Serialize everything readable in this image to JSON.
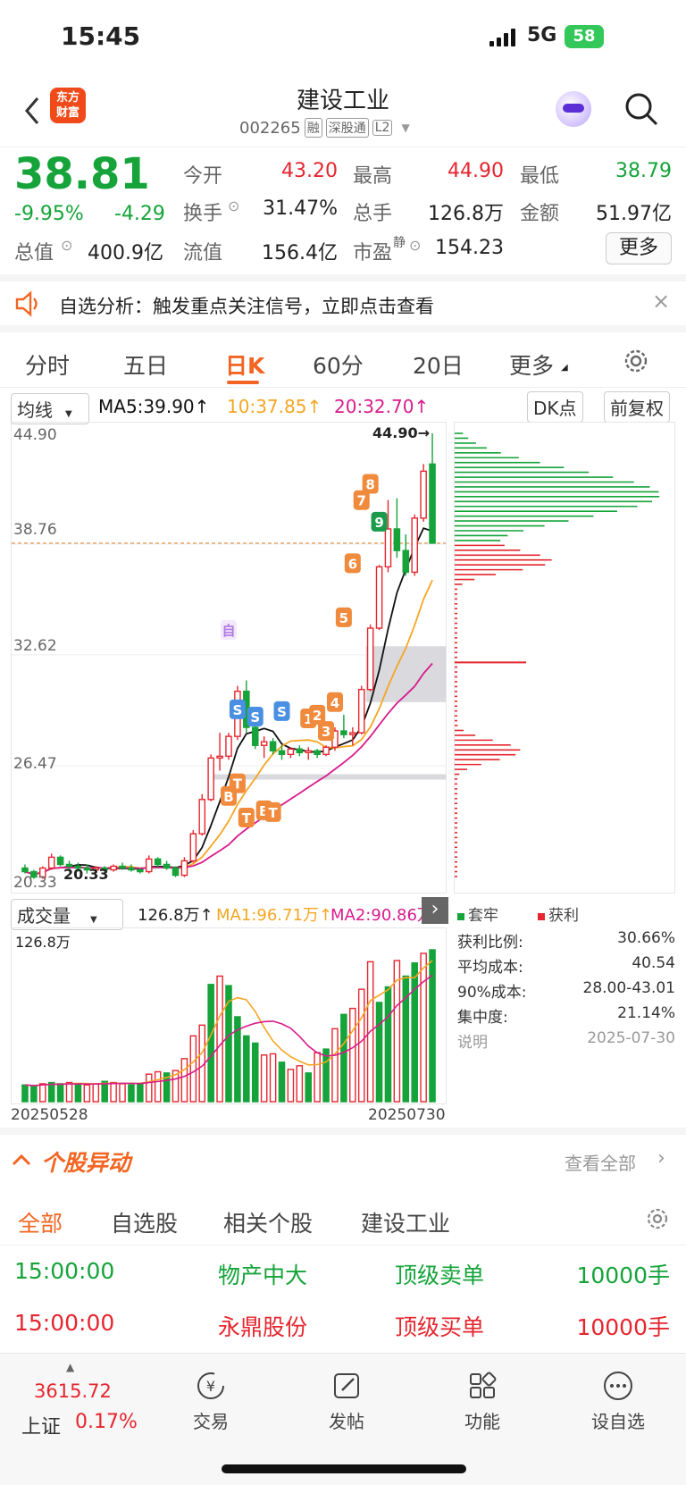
{
  "status_bar": {
    "time": "15:45",
    "network": "5G",
    "battery": "58"
  },
  "header": {
    "title": "建设工业",
    "code": "002265",
    "badges": [
      "融",
      "深股通",
      "L2"
    ],
    "brand": "东方\n财富"
  },
  "quote": {
    "price": "38.81",
    "change_pct": "-9.95%",
    "change": "-4.29",
    "fields": [
      {
        "label": "今开",
        "value": "43.20",
        "color": "red"
      },
      {
        "label": "最高",
        "value": "44.90",
        "color": "red"
      },
      {
        "label": "最低",
        "value": "38.79",
        "color": "green"
      },
      {
        "label": "换手",
        "value": "31.47%",
        "color": "black"
      },
      {
        "label": "总手",
        "value": "126.8万",
        "color": "black"
      },
      {
        "label": "金额",
        "value": "51.97亿",
        "color": "black"
      },
      {
        "label": "总值",
        "value": "400.9亿",
        "color": "black"
      },
      {
        "label": "流值",
        "value": "156.4亿",
        "color": "black"
      },
      {
        "label": "市盈",
        "value": "154.23",
        "color": "black",
        "sup": "静"
      }
    ],
    "more_label": "更多"
  },
  "banner": {
    "text": "自选分析：触发重点关注信号，立即点击查看"
  },
  "tabs": [
    "分时",
    "五日",
    "日K",
    "60分",
    "20日",
    "更多"
  ],
  "active_tab": "日K",
  "chart_bar": {
    "ma_select": "均线",
    "ma5": "MA5:39.90↑",
    "ma10": "10:37.85↑",
    "ma20": "20:32.70↑",
    "dk": "DK点",
    "adjust": "前复权"
  },
  "vol_bar": {
    "select": "成交量",
    "vol": "126.8万↑",
    "ma1": "MA1:96.71万↑",
    "ma2": "MA2:90.86万↑"
  },
  "colors": {
    "up": "#e5262f",
    "down": "#15a33a",
    "ma5": "#111111",
    "ma10": "#f5a623",
    "ma20": "#d81b8c"
  },
  "chart_data": {
    "type": "candlestick",
    "price_ticks": [
      "44.90",
      "38.76",
      "32.62",
      "26.47",
      "20.33"
    ],
    "high_marker": "44.90→",
    "low_marker": "20.33",
    "dates": [
      "20250528",
      "20250730"
    ],
    "vol_top_label": "126.8万",
    "markers": [
      "自",
      "S",
      "S",
      "S",
      "B",
      "T",
      "T",
      "B",
      "T",
      "1",
      "2",
      "3",
      "4",
      "5",
      "6",
      "7",
      "8",
      "9"
    ],
    "candles": [
      [
        20.8,
        21.0,
        20.5,
        20.6
      ],
      [
        20.6,
        20.7,
        20.2,
        20.3
      ],
      [
        20.3,
        20.9,
        20.2,
        20.8
      ],
      [
        20.8,
        21.6,
        20.7,
        21.4
      ],
      [
        21.4,
        21.5,
        20.9,
        21.0
      ],
      [
        21.0,
        21.2,
        20.7,
        20.9
      ],
      [
        20.9,
        21.1,
        20.6,
        20.8
      ],
      [
        20.8,
        21.0,
        20.5,
        20.7
      ],
      [
        20.7,
        20.9,
        20.5,
        20.8
      ],
      [
        20.8,
        20.9,
        20.6,
        20.7
      ],
      [
        20.7,
        21.0,
        20.6,
        20.9
      ],
      [
        20.9,
        21.1,
        20.7,
        20.8
      ],
      [
        20.8,
        21.0,
        20.6,
        20.7
      ],
      [
        20.7,
        20.8,
        20.5,
        20.6
      ],
      [
        20.6,
        21.5,
        20.5,
        21.3
      ],
      [
        21.3,
        21.4,
        20.8,
        21.0
      ],
      [
        21.0,
        21.2,
        20.7,
        20.8
      ],
      [
        20.8,
        20.9,
        20.3,
        20.4
      ],
      [
        20.4,
        21.4,
        20.3,
        21.2
      ],
      [
        21.2,
        22.9,
        21.1,
        22.7
      ],
      [
        22.7,
        24.9,
        22.6,
        24.6
      ],
      [
        24.6,
        27.1,
        24.5,
        26.9
      ],
      [
        26.9,
        28.3,
        26.2,
        27.0
      ],
      [
        27.0,
        28.3,
        26.8,
        28.1
      ],
      [
        28.1,
        30.9,
        27.9,
        30.6
      ],
      [
        30.6,
        31.2,
        28.3,
        28.6
      ],
      [
        28.6,
        28.9,
        27.4,
        27.6
      ],
      [
        27.6,
        28.1,
        26.9,
        27.8
      ],
      [
        27.8,
        28.0,
        27.1,
        27.3
      ],
      [
        27.3,
        27.6,
        26.8,
        27.1
      ],
      [
        27.1,
        27.5,
        26.9,
        27.4
      ],
      [
        27.4,
        27.6,
        27.0,
        27.2
      ],
      [
        27.2,
        27.5,
        26.8,
        27.3
      ],
      [
        27.3,
        27.4,
        26.9,
        27.1
      ],
      [
        27.1,
        27.6,
        27.0,
        27.5
      ],
      [
        27.5,
        28.6,
        27.3,
        28.4
      ],
      [
        28.4,
        29.3,
        28.0,
        28.2
      ],
      [
        28.2,
        28.6,
        27.6,
        28.3
      ],
      [
        28.3,
        30.9,
        28.2,
        30.7
      ],
      [
        30.7,
        34.3,
        30.6,
        34.1
      ],
      [
        34.1,
        37.6,
        34.0,
        37.5
      ],
      [
        37.5,
        41.2,
        37.2,
        39.6
      ],
      [
        39.6,
        41.3,
        38.0,
        38.4
      ],
      [
        38.4,
        39.3,
        37.0,
        37.2
      ],
      [
        37.2,
        40.4,
        37.0,
        40.2
      ],
      [
        40.2,
        43.2,
        40.0,
        42.8
      ],
      [
        43.2,
        44.9,
        38.79,
        38.81
      ]
    ],
    "volumes": [
      14,
      13,
      15,
      16,
      15,
      16,
      15,
      14,
      15,
      17,
      16,
      15,
      14,
      15,
      23,
      25,
      24,
      26,
      36,
      55,
      64,
      98,
      105,
      97,
      71,
      55,
      49,
      39,
      40,
      33,
      27,
      30,
      24,
      41,
      44,
      61,
      73,
      78,
      94,
      117,
      83,
      96,
      118,
      105,
      116,
      124,
      127
    ],
    "vol_up": [
      false,
      false,
      true,
      false,
      false,
      true,
      false,
      true,
      true,
      false,
      true,
      true,
      false,
      false,
      true,
      true,
      false,
      true,
      true,
      true,
      true,
      false,
      true,
      false,
      false,
      false,
      false,
      true,
      true,
      false,
      true,
      true,
      false,
      true,
      false,
      true,
      false,
      true,
      true,
      true,
      false,
      false,
      true,
      false,
      false,
      true,
      false
    ],
    "profile_stats": [
      {
        "label": "获利比例:",
        "value": "30.66%"
      },
      {
        "label": "平均成本:",
        "value": "40.54"
      },
      {
        "label": "90%成本:",
        "value": "28.00-43.01"
      },
      {
        "label": "集中度:",
        "value": "21.14%"
      },
      {
        "label": "说明",
        "value": "2025-07-30"
      }
    ],
    "legend": [
      "套牢",
      "获利"
    ]
  },
  "section": {
    "title": "个股异动",
    "see_all": "查看全部"
  },
  "subtabs": [
    "全部",
    "自选股",
    "相关个股",
    "建设工业"
  ],
  "rows": [
    {
      "time": "15:00:00",
      "name": "物产中大",
      "type": "顶级卖单",
      "qty": "10000手",
      "color": "green"
    },
    {
      "time": "15:00:00",
      "name": "永鼎股份",
      "type": "顶级买单",
      "qty": "10000手",
      "color": "red"
    }
  ],
  "bottom_nav": {
    "index_value": "3615.72",
    "index_name": "上证",
    "index_change": "0.17%",
    "items": [
      {
        "label": "交易",
        "icon": "yen-icon"
      },
      {
        "label": "发帖",
        "icon": "edit-icon"
      },
      {
        "label": "功能",
        "icon": "grid-icon"
      },
      {
        "label": "设自选",
        "icon": "more-icon"
      }
    ]
  }
}
